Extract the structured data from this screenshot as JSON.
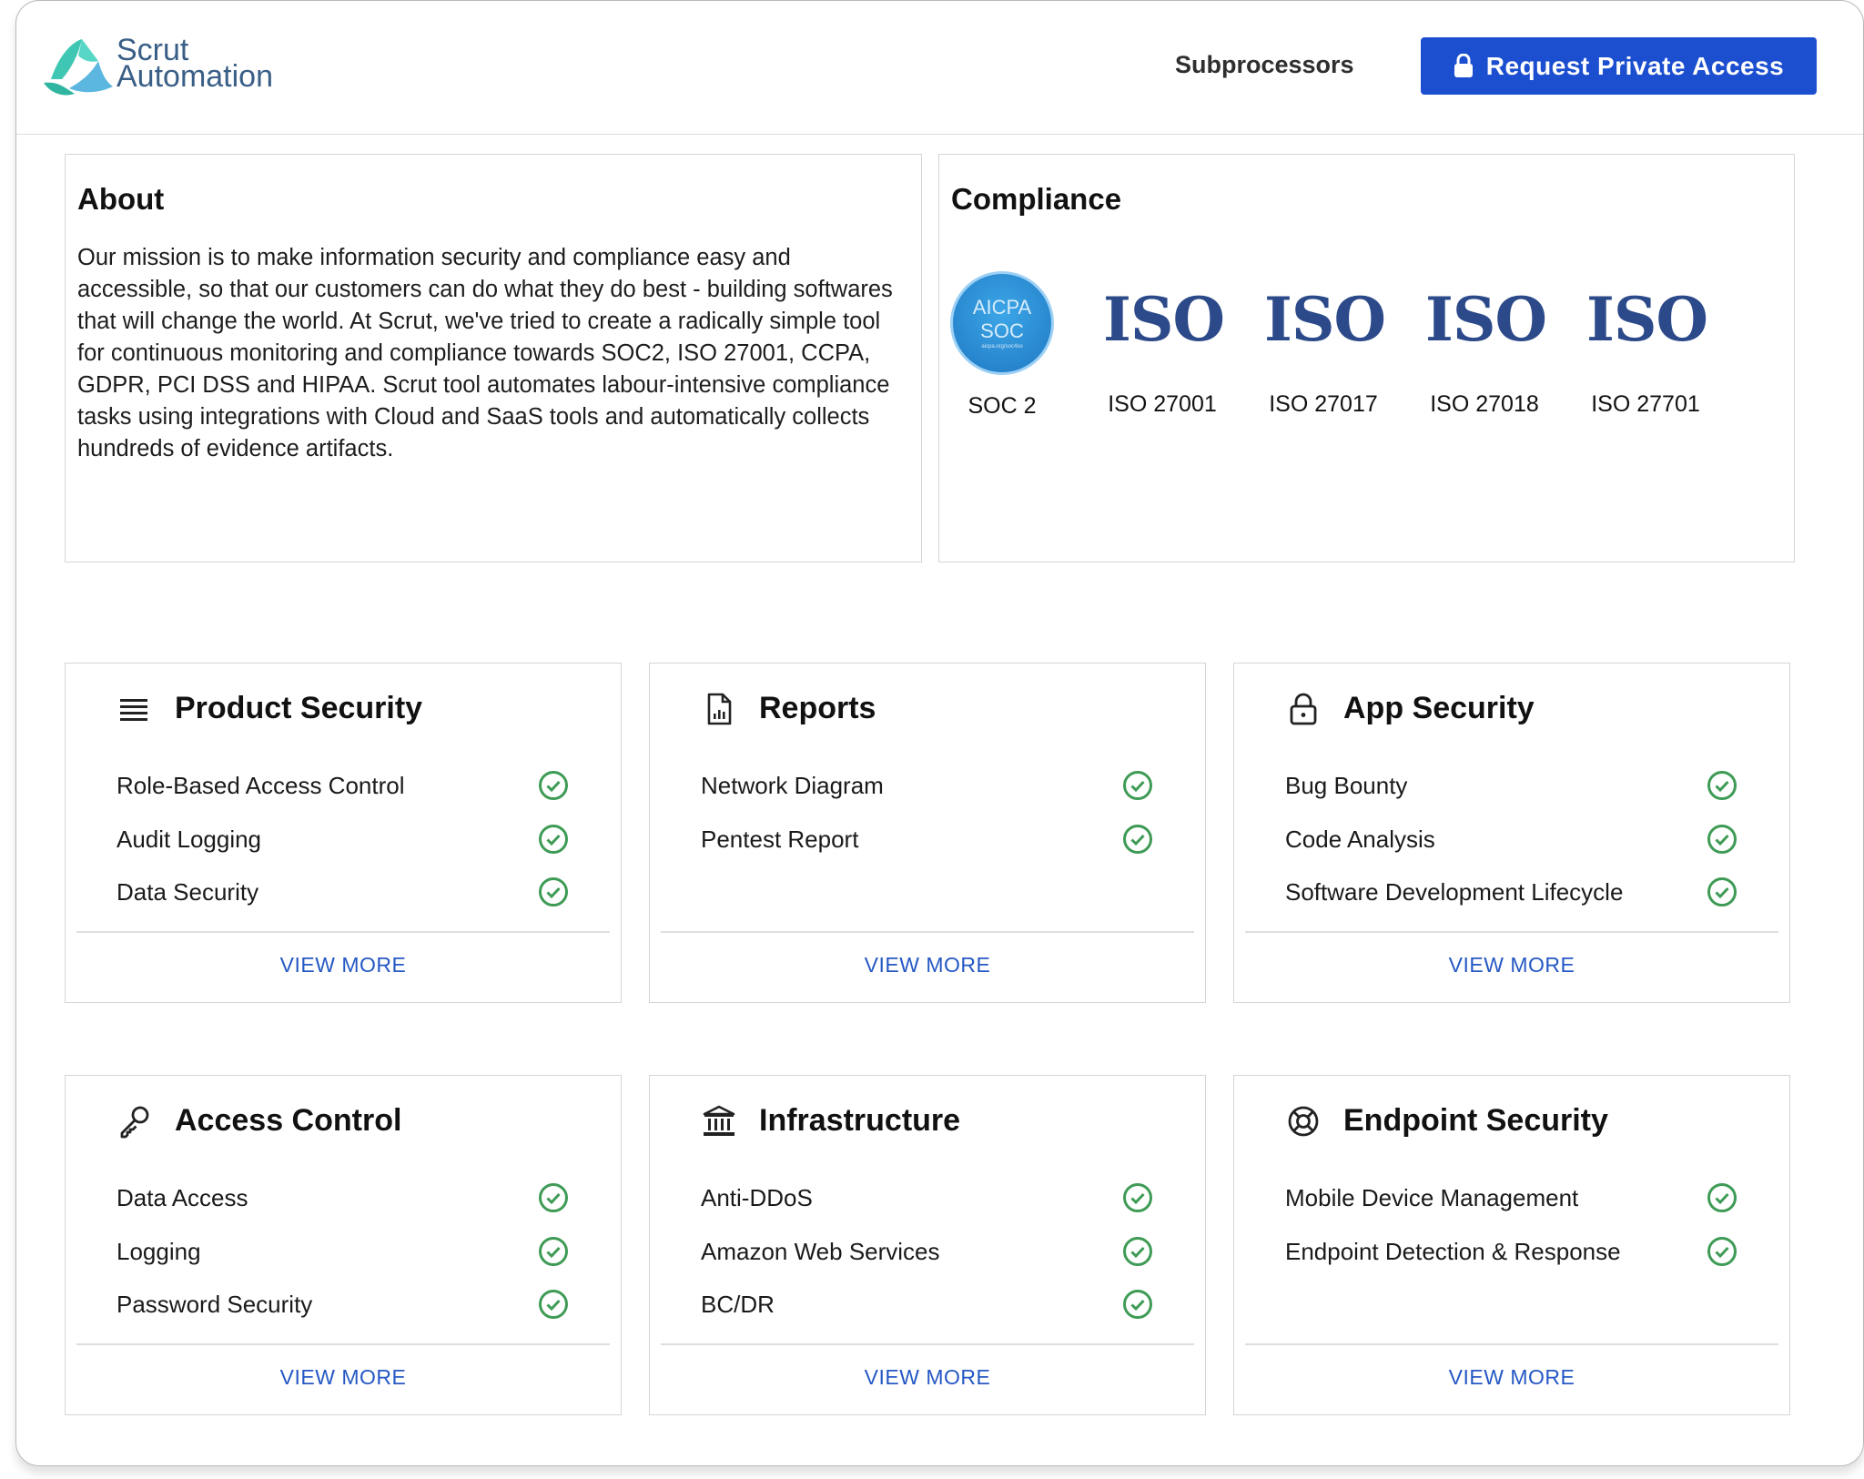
{
  "header": {
    "brand_line1": "Scrut",
    "brand_line2": "Automation",
    "nav_link": "Subprocessors",
    "cta_label": "Request Private Access"
  },
  "about": {
    "title": "About",
    "text": "Our mission is to make information security and compliance easy and accessible, so that our customers can do what they do best - building softwares that will change the world. At Scrut, we've tried to create a radically simple tool for continuous monitoring and compliance towards SOC2, ISO 27001, CCPA, GDPR, PCI DSS and HIPAA. Scrut tool automates labour-intensive compliance tasks using integrations with Cloud and SaaS tools and automatically collects hundreds of evidence artifacts."
  },
  "compliance": {
    "title": "Compliance",
    "soc_badge_line1": "AICPA",
    "soc_badge_line2": "SOC",
    "soc_badge_small": "aicpa.org/soc4so",
    "iso_mark": "ISO",
    "certs": [
      {
        "label": "SOC 2"
      },
      {
        "label": "ISO 27001"
      },
      {
        "label": "ISO 27017"
      },
      {
        "label": "ISO 27018"
      },
      {
        "label": "ISO 27701"
      }
    ]
  },
  "cards": [
    {
      "title": "Product Security",
      "icon": "list-icon",
      "items": [
        "Role-Based Access Control",
        "Audit Logging",
        "Data Security"
      ],
      "view_more": "VIEW MORE"
    },
    {
      "title": "Reports",
      "icon": "report-file-icon",
      "items": [
        "Network Diagram",
        "Pentest Report"
      ],
      "view_more": "VIEW MORE"
    },
    {
      "title": "App Security",
      "icon": "lock-icon",
      "items": [
        "Bug Bounty",
        "Code Analysis",
        "Software Development Lifecycle"
      ],
      "view_more": "VIEW MORE"
    },
    {
      "title": "Access Control",
      "icon": "key-icon",
      "items": [
        "Data Access",
        "Logging",
        "Password Security"
      ],
      "view_more": "VIEW MORE"
    },
    {
      "title": "Infrastructure",
      "icon": "building-icon",
      "items": [
        "Anti-DDoS",
        "Amazon Web Services",
        "BC/DR"
      ],
      "view_more": "VIEW MORE"
    },
    {
      "title": "Endpoint Security",
      "icon": "lifebuoy-icon",
      "items": [
        "Mobile Device Management",
        "Endpoint Detection & Response"
      ],
      "view_more": "VIEW MORE"
    }
  ],
  "colors": {
    "accent": "#1c4fcf",
    "link": "#2558c4",
    "check": "#3e9b55",
    "brand": "#3a5f87",
    "logo_teal": "#40c9b8"
  }
}
